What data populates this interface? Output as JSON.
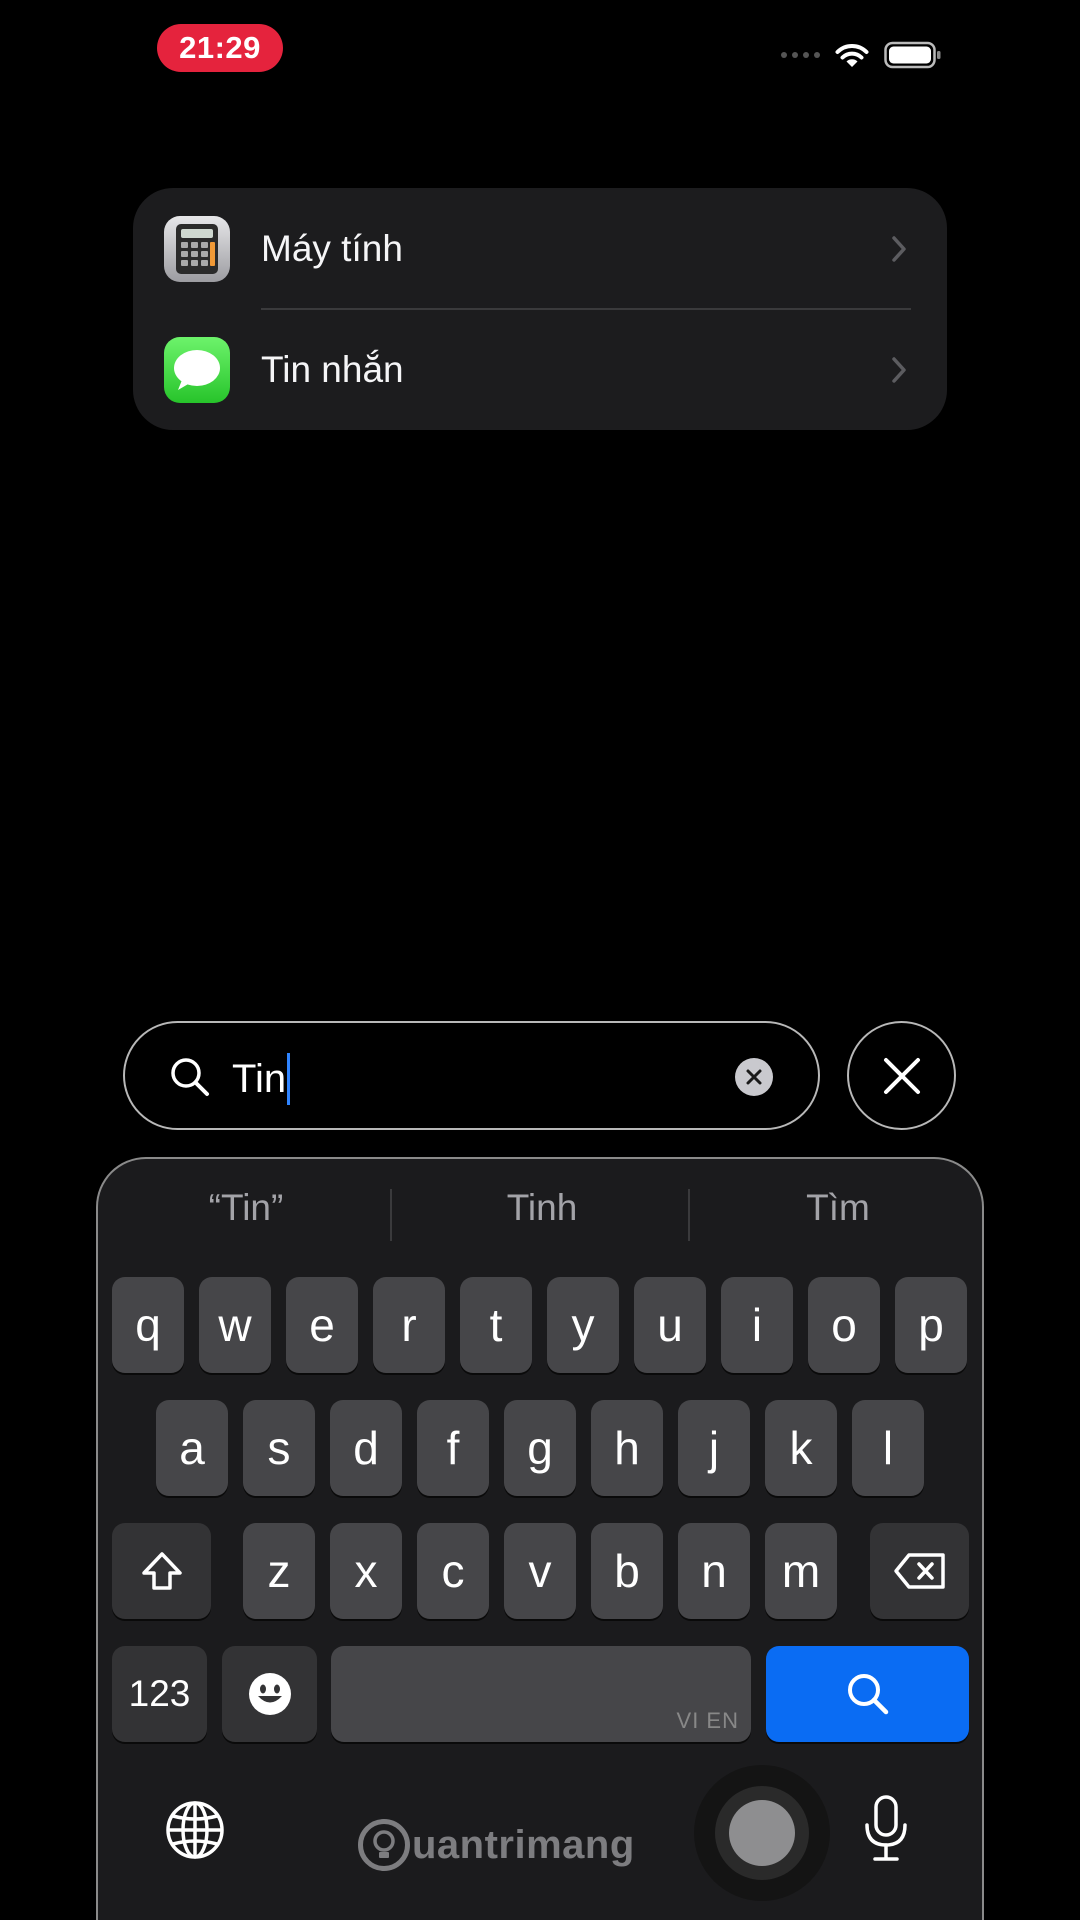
{
  "status_bar": {
    "time": "21:29"
  },
  "results": [
    {
      "label": "Máy tính",
      "icon": "calculator-icon"
    },
    {
      "label": "Tin nhắn",
      "icon": "messages-icon"
    }
  ],
  "search": {
    "query": "Tin"
  },
  "keyboard": {
    "suggestions": [
      "“Tin”",
      "Tinh",
      "Tìm"
    ],
    "row1": [
      "q",
      "w",
      "e",
      "r",
      "t",
      "y",
      "u",
      "i",
      "o",
      "p"
    ],
    "row2": [
      "a",
      "s",
      "d",
      "f",
      "g",
      "h",
      "j",
      "k",
      "l"
    ],
    "row3": [
      "z",
      "x",
      "c",
      "v",
      "b",
      "n",
      "m"
    ],
    "numbers_label": "123",
    "space_language": "VI EN"
  },
  "watermark": {
    "text": "uantrimang"
  },
  "colors": {
    "time_pill": "#e5233d",
    "search_key": "#0a6cf3",
    "caret": "#2f84ff"
  }
}
